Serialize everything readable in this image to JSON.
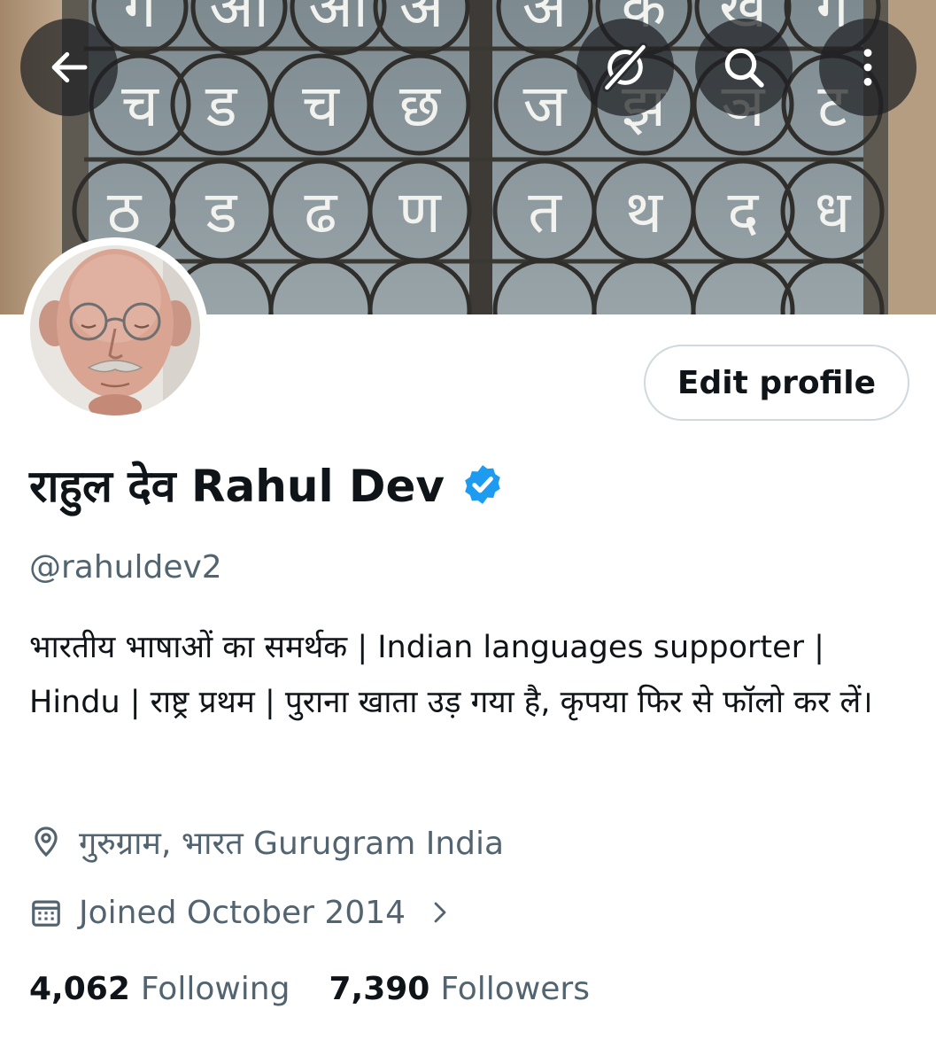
{
  "banner": {
    "devanagari_letters_row1": [
      "ग",
      "आ",
      "आ",
      "अ",
      "अ",
      "क",
      "ख",
      "ग"
    ],
    "devanagari_letters_row2": [
      "च",
      "ड",
      "च",
      "छ",
      "ज",
      "झ",
      "ञ",
      "ट"
    ],
    "devanagari_letters_row3": [
      "ठ",
      "ड",
      "ढ",
      "ण",
      "त",
      "थ",
      "द",
      "ध"
    ]
  },
  "toolbar": {
    "back_icon": "arrow-left-icon",
    "grok_icon": "grok-icon",
    "search_icon": "search-icon",
    "more_icon": "more-vertical-icon"
  },
  "profile": {
    "edit_label": "Edit profile",
    "name": "राहुल देव Rahul Dev",
    "verified_color": "#1d9bf0",
    "handle": "@rahuldev2",
    "bio": "भारतीय भाषाओं का समर्थक  | Indian languages supporter | Hindu | राष्ट्र प्रथम | पुराना खाता उड़ गया है, कृपया फिर से फॉलो कर लें।",
    "location": "गुरुग्राम, भारत Gurugram India",
    "joined": "Joined October 2014",
    "following_count": "4,062",
    "following_label": "Following",
    "followers_count": "7,390",
    "followers_label": "Followers"
  },
  "colors": {
    "primary_text": "#0f1419",
    "secondary_text": "#536471",
    "border": "#cfd9de"
  }
}
